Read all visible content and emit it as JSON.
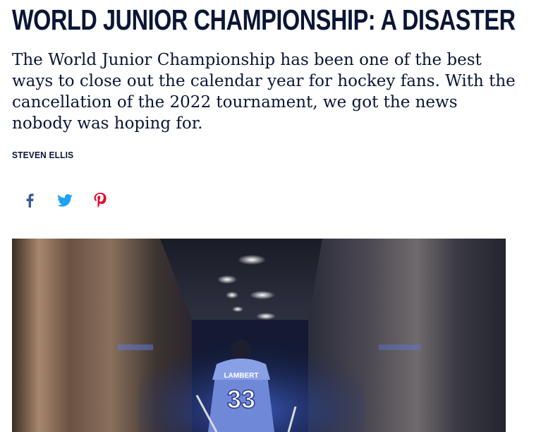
{
  "article": {
    "headline": "WORLD JUNIOR CHAMPIONSHIP: A DISASTER",
    "dek_lines": [
      "The World Junior Championship has been one of the best",
      "ways to close out the calendar year for hockey fans. With the",
      "cancellation of the 2022 tournament, we got the news",
      "nobody was hoping for."
    ],
    "author": "STEVEN ELLIS"
  },
  "share": {
    "items": [
      {
        "icon": "facebook-icon",
        "color": "#3b5998"
      },
      {
        "icon": "twitter-icon",
        "color": "#1da1f2"
      },
      {
        "icon": "pinterest-icon",
        "color": "#e60023"
      }
    ]
  },
  "hero_image": {
    "jersey_name": "LAMBERT",
    "jersey_number": "33"
  },
  "colors": {
    "text": "#0b1635",
    "background": "#ffffff"
  }
}
